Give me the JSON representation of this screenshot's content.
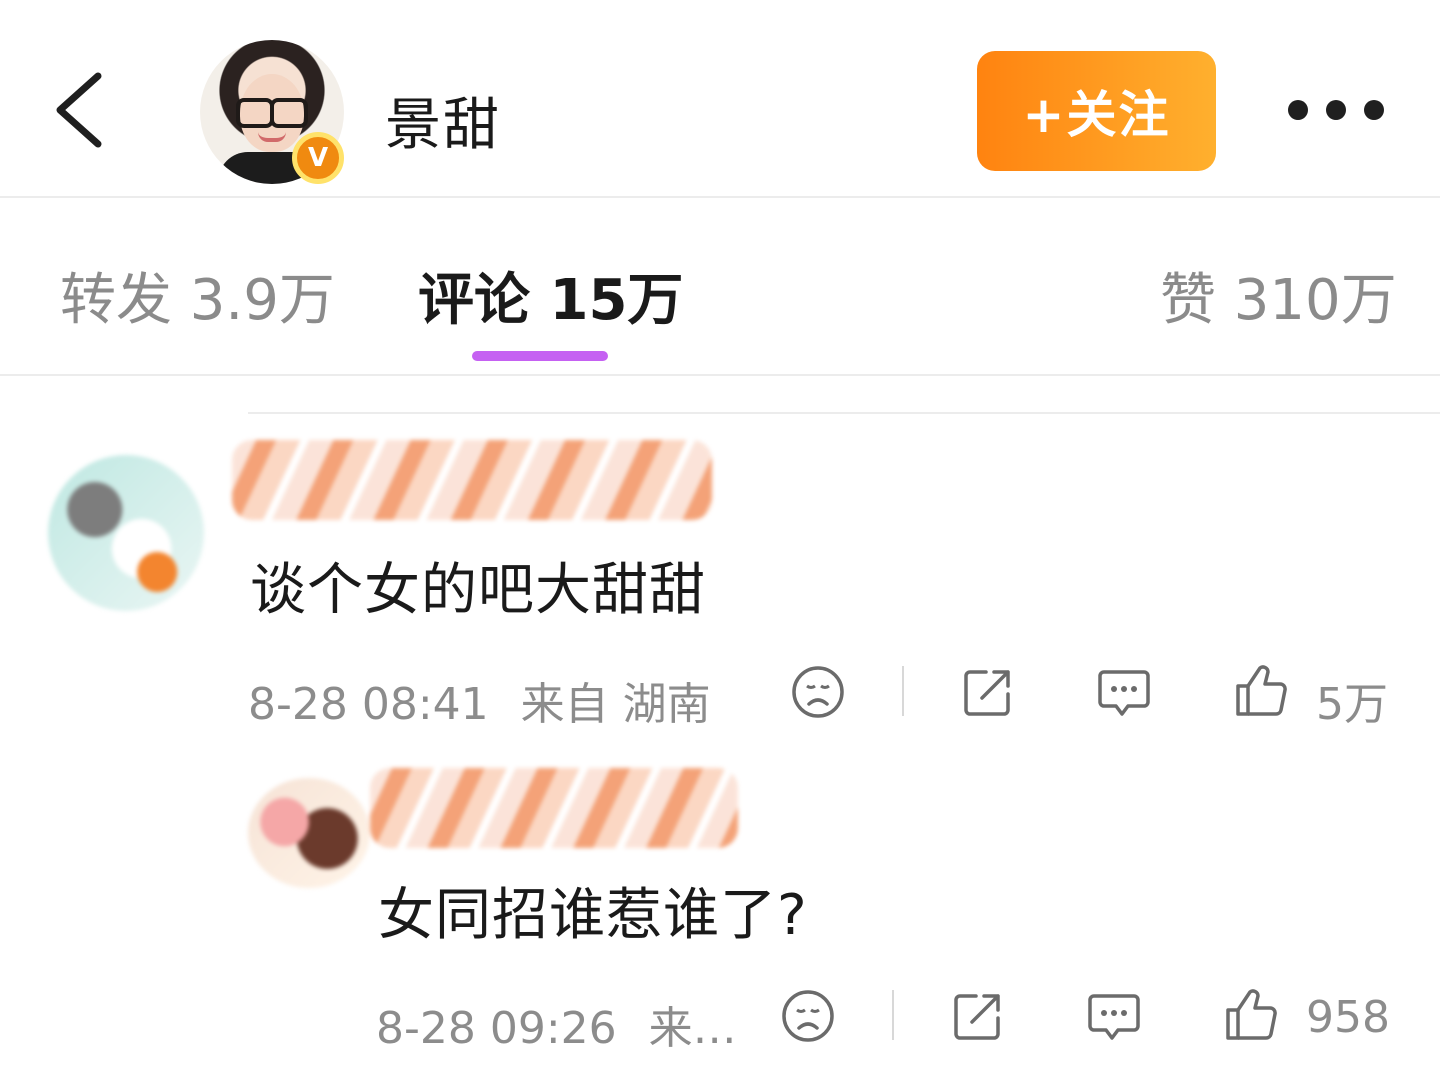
{
  "header": {
    "user_name": "景甜",
    "verified_badge": "V",
    "follow_label": "+关注",
    "icons": [
      "back-arrow-icon",
      "verified-icon",
      "more-dots-icon"
    ]
  },
  "tabs": [
    {
      "label": "转发 3.9万",
      "active": false
    },
    {
      "label": "评论 15万",
      "active": true
    },
    {
      "label": "赞 310万",
      "active": false
    }
  ],
  "comments": [
    {
      "text": "谈个女的吧大甜甜",
      "time": "8-28 08:41",
      "location": "来自 湖南",
      "likes": "5万"
    }
  ],
  "replies": [
    {
      "text": "女同招谁惹谁了?",
      "time": "8-28 09:26",
      "location": "来…",
      "likes": "958"
    }
  ],
  "colors": {
    "accent_orange_start": "#ff8310",
    "accent_orange_end": "#ffb02e",
    "tab_underline": "#c561f2",
    "meta_gray": "#8c8c8c"
  }
}
